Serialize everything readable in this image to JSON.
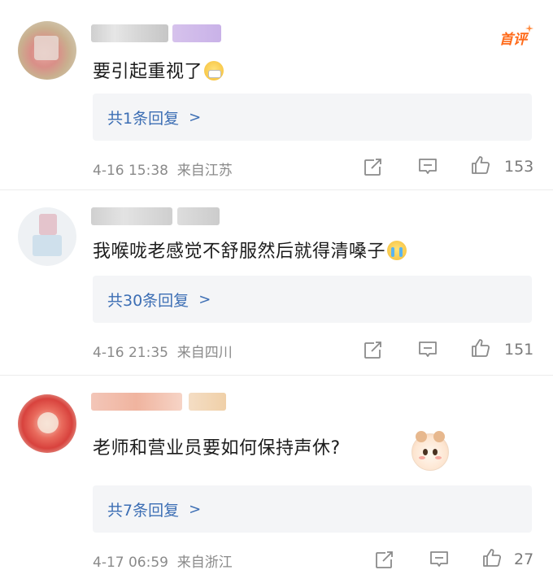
{
  "comments": [
    {
      "text": "要引起重视了",
      "emoji": "mask-face-emoji",
      "badge": "首评",
      "replies_label": "共1条回复",
      "time": "4-16 15:38",
      "location": "来自江苏",
      "likes": "153"
    },
    {
      "text": "我喉咙老感觉不舒服然后就得清嗓子",
      "emoji": "crying-face-emoji",
      "replies_label": "共30条回复",
      "time": "4-16 21:35",
      "location": "来自四川",
      "likes": "151"
    },
    {
      "text": "老师和营业员要如何保持声休?",
      "emoji": "cute-bear-sticker",
      "replies_label": "共7条回复",
      "time": "4-17 06:59",
      "location": "来自浙江",
      "likes": "27"
    }
  ],
  "ui": {
    "chevron": ">",
    "accent_color": "#3c6eb4",
    "badge_color": "#ff6b1a"
  }
}
